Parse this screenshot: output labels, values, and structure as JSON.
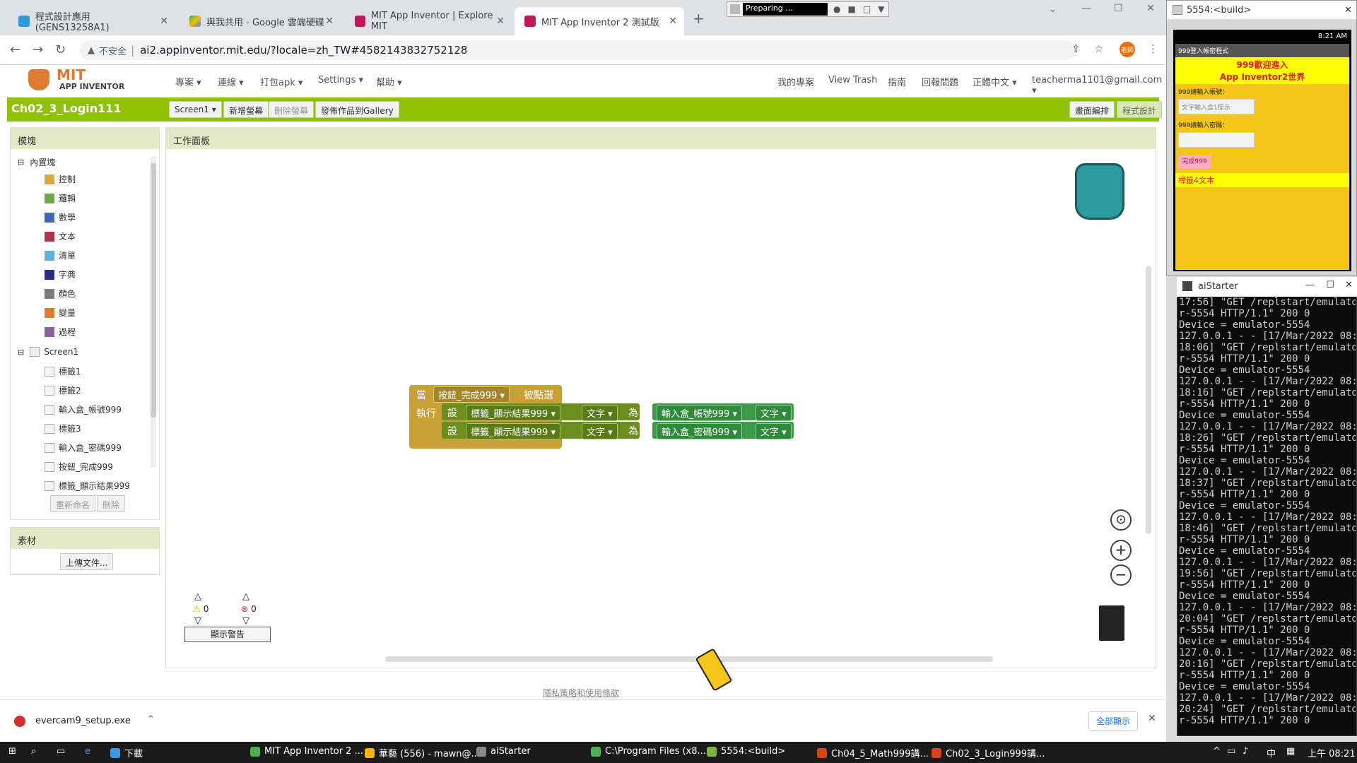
{
  "browser": {
    "tabs": [
      {
        "title": "程式設計應用 (GENS13258A1)"
      },
      {
        "title": "與我共用 - Google 雲端硬碟"
      },
      {
        "title": "MIT App Inventor | Explore MIT"
      },
      {
        "title": "MIT App Inventor 2 測試版"
      }
    ],
    "new_tab": "+",
    "recorder_label": "Preparing ...",
    "security": "不安全",
    "url": "ai2.appinventor.mit.edu/?locale=zh_TW#4582143832752128",
    "profile_badge": "老師"
  },
  "appinventor": {
    "logo_line1": "MIT",
    "logo_line2": "APP INVENTOR",
    "menus": [
      "專案 ▾",
      "連線 ▾",
      "打包apk ▾",
      "Settings ▾",
      "幫助 ▾"
    ],
    "right_menus": [
      "我的專案",
      "View Trash",
      "指南",
      "回報問題",
      "正體中文 ▾",
      "teacherma1101@gmail.com ▾"
    ],
    "project_name": "Ch02_3_Login111",
    "screen_select": "Screen1 ▾",
    "buttons": [
      "新增螢幕",
      "刪除螢幕",
      "發佈作品到Gallery"
    ],
    "mode_buttons": [
      "畫面編排",
      "程式設計"
    ],
    "blocks_header": "模塊",
    "builtin_label": "內置塊",
    "builtin": [
      {
        "label": "控制",
        "color": "#d6a940"
      },
      {
        "label": "邏輯",
        "color": "#6fa84a"
      },
      {
        "label": "數學",
        "color": "#3a68b5"
      },
      {
        "label": "文本",
        "color": "#b3314e"
      },
      {
        "label": "清單",
        "color": "#5ab4d6"
      },
      {
        "label": "字典",
        "color": "#2b2a8c"
      },
      {
        "label": "顏色",
        "color": "#7a7a7a"
      },
      {
        "label": "變量",
        "color": "#e07a2e"
      },
      {
        "label": "過程",
        "color": "#8a5f9e"
      }
    ],
    "screen_node": "Screen1",
    "components": [
      "標籤1",
      "標籤2",
      "輸入盒_帳號999",
      "標籤3",
      "輸入盒_密碼999",
      "按鈕_完成999",
      "標籤_顯示結果999"
    ],
    "rename_btn": "重新命名",
    "delete_btn": "刪除",
    "assets_header": "素材",
    "upload_btn": "上傳文件...",
    "workspace_header": "工作面板",
    "warnings_count": "0",
    "errors_count": "0",
    "show_warnings": "顯示警告",
    "footer_link": "隱私策略和使用條款"
  },
  "blocks": {
    "event_when": "當",
    "event_component": "按鈕_完成999 ▾",
    "event_name": "被點選",
    "do_label": "執行",
    "set_label": "設",
    "to_label": "為",
    "row1": {
      "target": "標籤_顯示結果999 ▾",
      "prop": "文字 ▾",
      "source": "輸入盒_帳號999 ▾",
      "source_prop": "文字 ▾"
    },
    "row2": {
      "target": "標籤_顯示結果999 ▾",
      "prop": "文字 ▾",
      "source": "輸入盒_密碼999 ▾",
      "source_prop": "文字 ▾"
    }
  },
  "emulator": {
    "title": "5554:<build>",
    "time": "8:21 AM",
    "app_title": "999登入帳密程式",
    "heading_line1": "999歡迎進入",
    "heading_line2": "App Inventor2世界",
    "account_label": "999請輸入帳號：",
    "account_hint": "文字輸入盒1提示",
    "password_label": "999請輸入密碼：",
    "button": "完成999",
    "result_label": "標籤4文本"
  },
  "aistarter": {
    "title": "aiStarter",
    "log": "17:56] \"GET /replstart/emulato\nr-5554 HTTP/1.1\" 200 0\nDevice = emulator-5554\n127.0.0.1 - - [17/Mar/2022 08:\n18:06] \"GET /replstart/emulato\nr-5554 HTTP/1.1\" 200 0\nDevice = emulator-5554\n127.0.0.1 - - [17/Mar/2022 08:\n18:16] \"GET /replstart/emulato\nr-5554 HTTP/1.1\" 200 0\nDevice = emulator-5554\n127.0.0.1 - - [17/Mar/2022 08:\n18:26] \"GET /replstart/emulato\nr-5554 HTTP/1.1\" 200 0\nDevice = emulator-5554\n127.0.0.1 - - [17/Mar/2022 08:\n18:37] \"GET /replstart/emulato\nr-5554 HTTP/1.1\" 200 0\nDevice = emulator-5554\n127.0.0.1 - - [17/Mar/2022 08:\n18:46] \"GET /replstart/emulato\nr-5554 HTTP/1.1\" 200 0\nDevice = emulator-5554\n127.0.0.1 - - [17/Mar/2022 08:\n19:56] \"GET /replstart/emulato\nr-5554 HTTP/1.1\" 200 0\nDevice = emulator-5554\n127.0.0.1 - - [17/Mar/2022 08:\n20:04] \"GET /replstart/emulato\nr-5554 HTTP/1.1\" 200 0\nDevice = emulator-5554\n127.0.0.1 - - [17/Mar/2022 08:\n20:16] \"GET /replstart/emulato\nr-5554 HTTP/1.1\" 200 0\nDevice = emulator-5554\n127.0.0.1 - - [17/Mar/2022 08:\n20:24] \"GET /replstart/emulato\nr-5554 HTTP/1.1\" 200 0"
  },
  "download": {
    "file": "evercam9_setup.exe",
    "show_all": "全部顯示"
  },
  "taskbar": {
    "items": [
      "下載",
      "MIT App Inventor 2 ...",
      "華藝 (556) - mawn@...",
      "aiStarter",
      "C:\\Program Files (x8...",
      "5554:<build>",
      "Ch04_5_Math999講...",
      "Ch02_3_Login999講..."
    ],
    "ime": "中",
    "clock": "上午 08:21"
  }
}
